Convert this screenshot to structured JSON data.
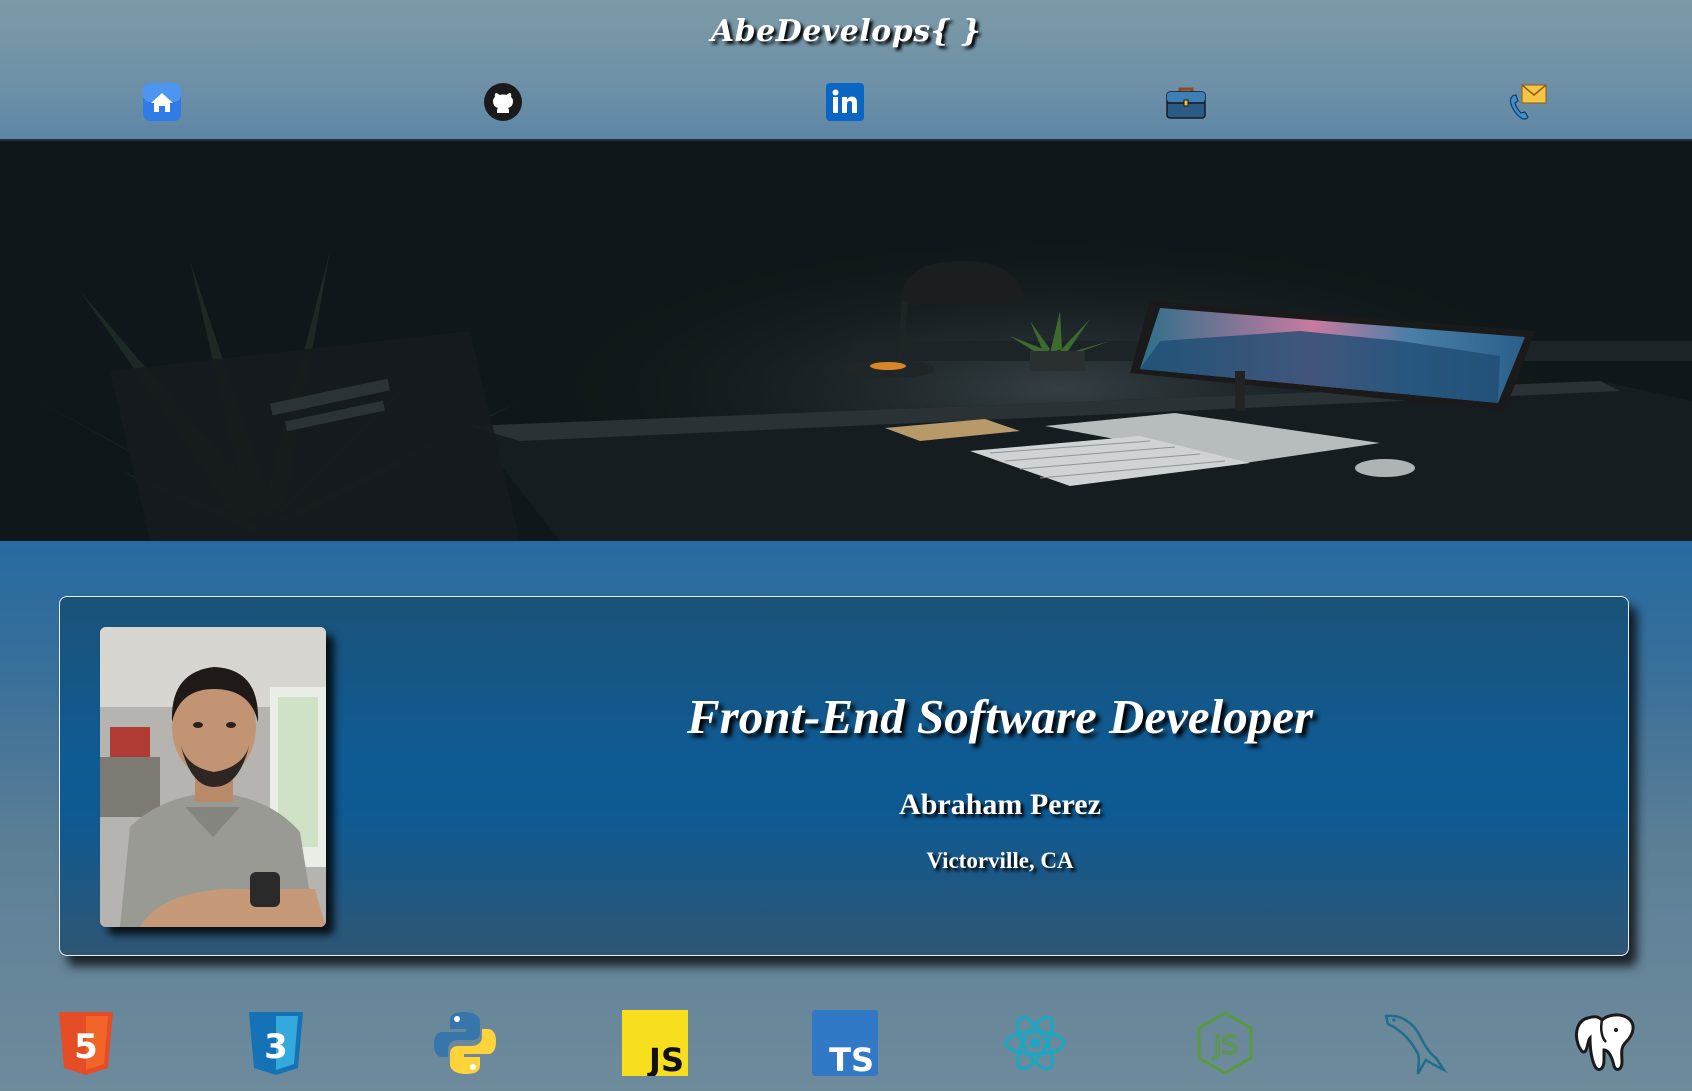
{
  "header": {
    "brand": "AbeDevelops{ }",
    "nav": [
      {
        "icon": "home-icon"
      },
      {
        "icon": "github-icon"
      },
      {
        "icon": "linkedin-icon"
      },
      {
        "icon": "briefcase-icon"
      },
      {
        "icon": "contact-icon"
      }
    ]
  },
  "hero": {
    "image": "dark-desk-workspace-photo"
  },
  "profile": {
    "headline": "Front-End Software Developer",
    "name": "Abraham Perez",
    "location": "Victorville, CA",
    "photo": "profile-portrait-photo"
  },
  "tech_stack": [
    {
      "icon": "html5-icon",
      "text": "5"
    },
    {
      "icon": "css3-icon",
      "text": "3"
    },
    {
      "icon": "python-icon"
    },
    {
      "icon": "javascript-icon",
      "text": "JS"
    },
    {
      "icon": "typescript-icon",
      "text": "TS"
    },
    {
      "icon": "react-icon"
    },
    {
      "icon": "nodejs-icon",
      "text": "JS"
    },
    {
      "icon": "mysql-icon"
    },
    {
      "icon": "postgresql-icon"
    }
  ],
  "colors": {
    "header": "#6e91a7",
    "band": "#276aa1",
    "card": "#0f5b94"
  }
}
